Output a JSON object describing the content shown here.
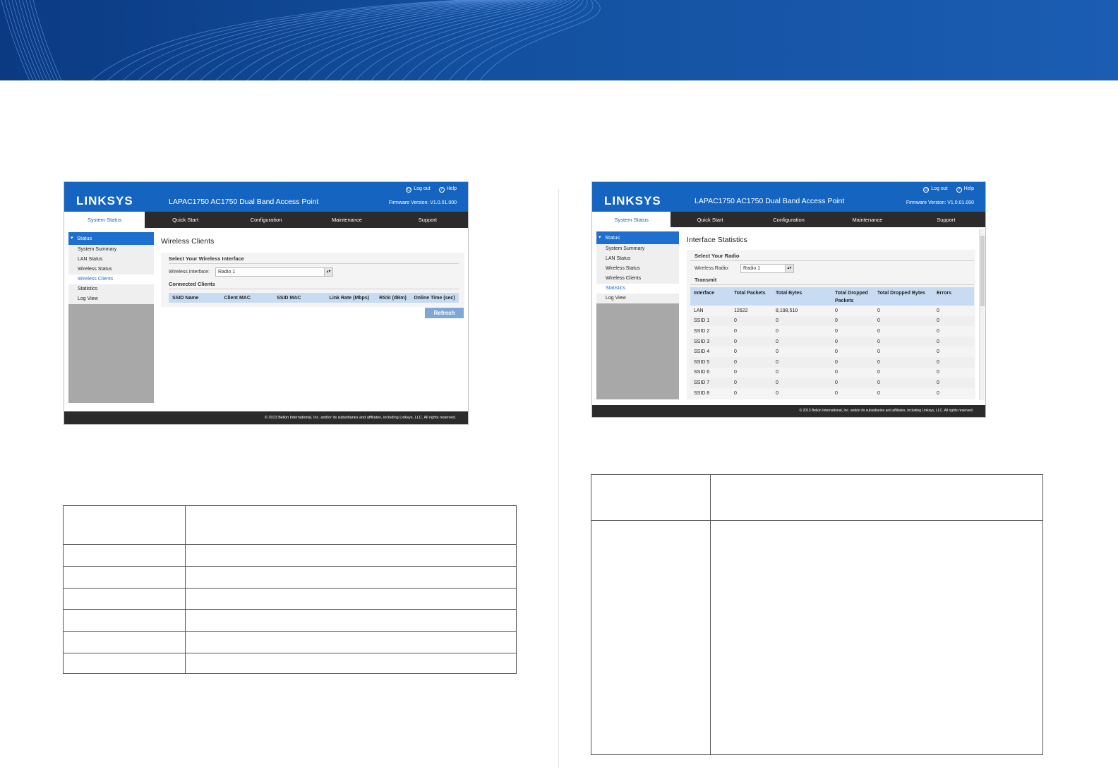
{
  "colors": {
    "banner": "#114a9c",
    "header_blue": "#1565c0",
    "nav_dark": "#2b2b2b",
    "accent": "#1e6fd0",
    "button": "#7fa7d6"
  },
  "app": {
    "logo": "LINKSYS",
    "model": "LAPAC1750 AC1750 Dual Band Access Point",
    "firmware": "Firmware Version: V1.0.01.000",
    "logout": "Log out",
    "help": "Help",
    "footer": "© 2013 Belkin International, Inc. and/or its subsidiaries and affiliates, including Linksys, LLC. All rights reserved.",
    "nav": [
      "System Status",
      "Quick Start",
      "Configuration",
      "Maintenance",
      "Support"
    ],
    "sidebar": {
      "section": "Status",
      "items": [
        "System Summary",
        "LAN Status",
        "Wireless Status",
        "Wireless Clients",
        "Statistics",
        "Log View"
      ]
    }
  },
  "left_shot": {
    "title": "Wireless Clients",
    "section1": "Select Your Wireless Interface",
    "field_label": "Wireless Interface:",
    "field_value": "Radio 1",
    "section2": "Connected Clients",
    "columns": [
      "SSID Name",
      "Client MAC",
      "SSID MAC",
      "Link Rate (Mbps)",
      "RSSI (dBm)",
      "Online Time (sec)"
    ],
    "refresh": "Refresh",
    "active_item": "Wireless Clients"
  },
  "right_shot": {
    "title": "Interface Statistics",
    "section1": "Select Your Radio",
    "field_label": "Wireless Radio:",
    "field_value": "Radio 1",
    "section2": "Transmit",
    "active_item": "Statistics",
    "columns": [
      "Interface",
      "Total Packets",
      "Total Bytes",
      "Total Dropped Packets",
      "Total Dropped Bytes",
      "Errors"
    ],
    "rows": [
      [
        "LAN",
        "12622",
        "8,198,510",
        "0",
        "0",
        "0"
      ],
      [
        "SSID 1",
        "0",
        "0",
        "0",
        "0",
        "0"
      ],
      [
        "SSID 2",
        "0",
        "0",
        "0",
        "0",
        "0"
      ],
      [
        "SSID 3",
        "0",
        "0",
        "0",
        "0",
        "0"
      ],
      [
        "SSID 4",
        "0",
        "0",
        "0",
        "0",
        "0"
      ],
      [
        "SSID 5",
        "0",
        "0",
        "0",
        "0",
        "0"
      ],
      [
        "SSID 6",
        "0",
        "0",
        "0",
        "0",
        "0"
      ],
      [
        "SSID 7",
        "0",
        "0",
        "0",
        "0",
        "0"
      ],
      [
        "SSID 8",
        "0",
        "0",
        "0",
        "0",
        "0"
      ]
    ]
  }
}
